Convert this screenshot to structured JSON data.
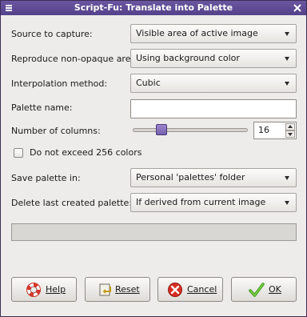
{
  "window": {
    "title": "Script-Fu: Translate into Palette"
  },
  "form": {
    "source": {
      "label": "Source to capture:",
      "value": "Visible area of active image"
    },
    "nonopaque": {
      "label": "Reproduce non-opaque areas:",
      "value": "Using background color"
    },
    "interpolation": {
      "label": "Interpolation method:",
      "value": "Cubic"
    },
    "palette_name": {
      "label": "Palette name:",
      "value": ""
    },
    "columns": {
      "label": "Number of columns:",
      "value": "16",
      "slider_level": 0.22
    },
    "limit_colors": {
      "label": "Do not exceed 256 colors",
      "checked": false
    },
    "save_in": {
      "label": "Save palette in:",
      "value": "Personal 'palettes' folder"
    },
    "delete_last": {
      "label": "Delete last created palette:",
      "value": "If derived from current image"
    }
  },
  "progress": {
    "value": 0
  },
  "buttons": {
    "help": {
      "label": "Help"
    },
    "reset": {
      "label": "Reset"
    },
    "cancel": {
      "label": "Cancel"
    },
    "ok": {
      "label": "OK"
    }
  },
  "icons": {
    "menu": "window-menu-icon",
    "close": "close-icon",
    "help": "lifebuoy-icon",
    "reset": "reset-icon",
    "cancel": "cancel-icon",
    "ok": "checkmark-icon"
  },
  "colors": {
    "titlebar": "#5f4a94",
    "slider_thumb": "#8470bd",
    "dialog_bg": "#edeceb"
  }
}
